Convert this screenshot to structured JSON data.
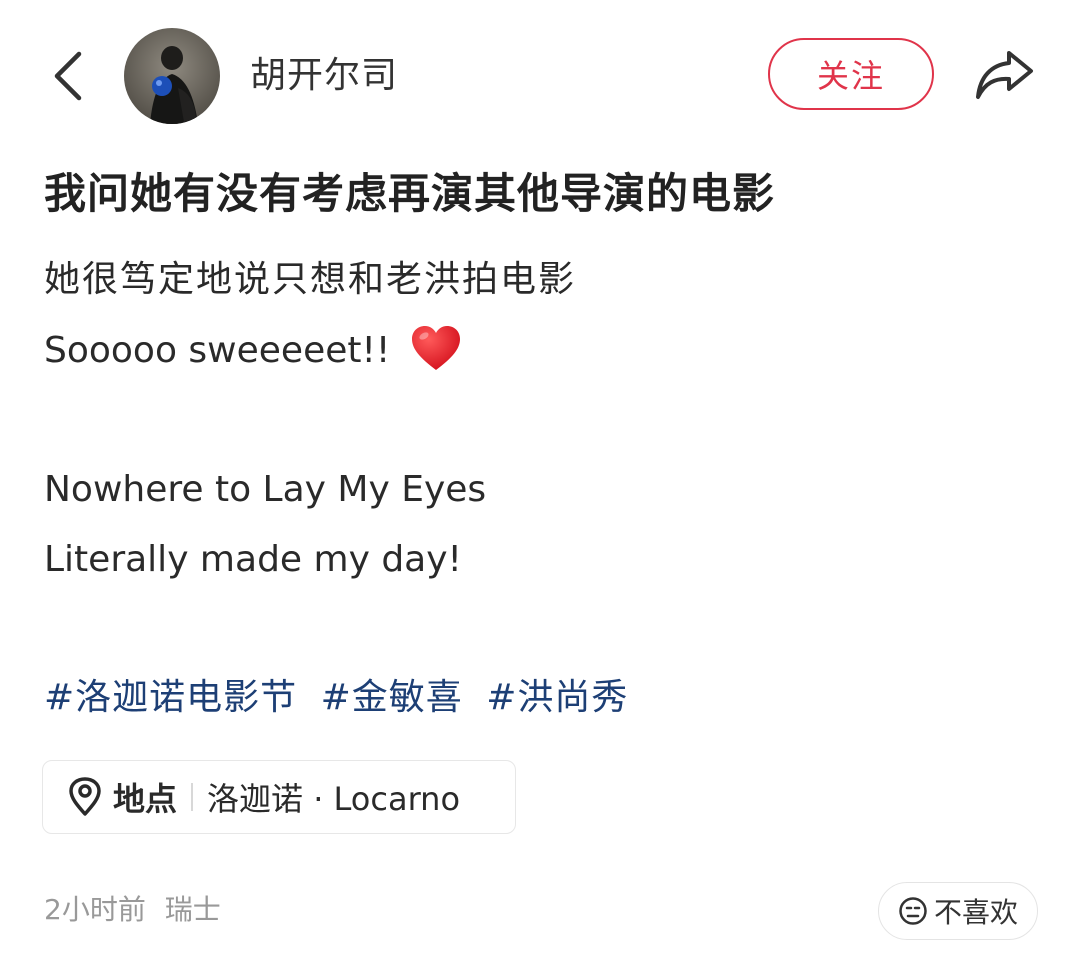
{
  "header": {
    "author_name": "胡开尔司",
    "follow_label": "关注",
    "icons": {
      "back": "chevron-left-icon",
      "share": "share-icon"
    }
  },
  "post": {
    "title": "我问她有没有考虑再演其他导演的电影",
    "body_lines": [
      "她很笃定地说只想和老洪拍电影",
      "Sooooo sweeeeet!!",
      "Nowhere to Lay My Eyes",
      "Literally made my day!"
    ],
    "emoji": "heart-icon",
    "hashtags": [
      "#洛迦诺电影节",
      "#金敏喜",
      "#洪尚秀"
    ],
    "location": {
      "label": "地点",
      "name": "洛迦诺 · Locarno"
    }
  },
  "footer": {
    "time": "2小时前",
    "region": "瑞士",
    "dislike_label": "不喜欢"
  },
  "colors": {
    "accent": "#e0344a",
    "hashtag": "#1d3f75",
    "muted": "#999999"
  }
}
